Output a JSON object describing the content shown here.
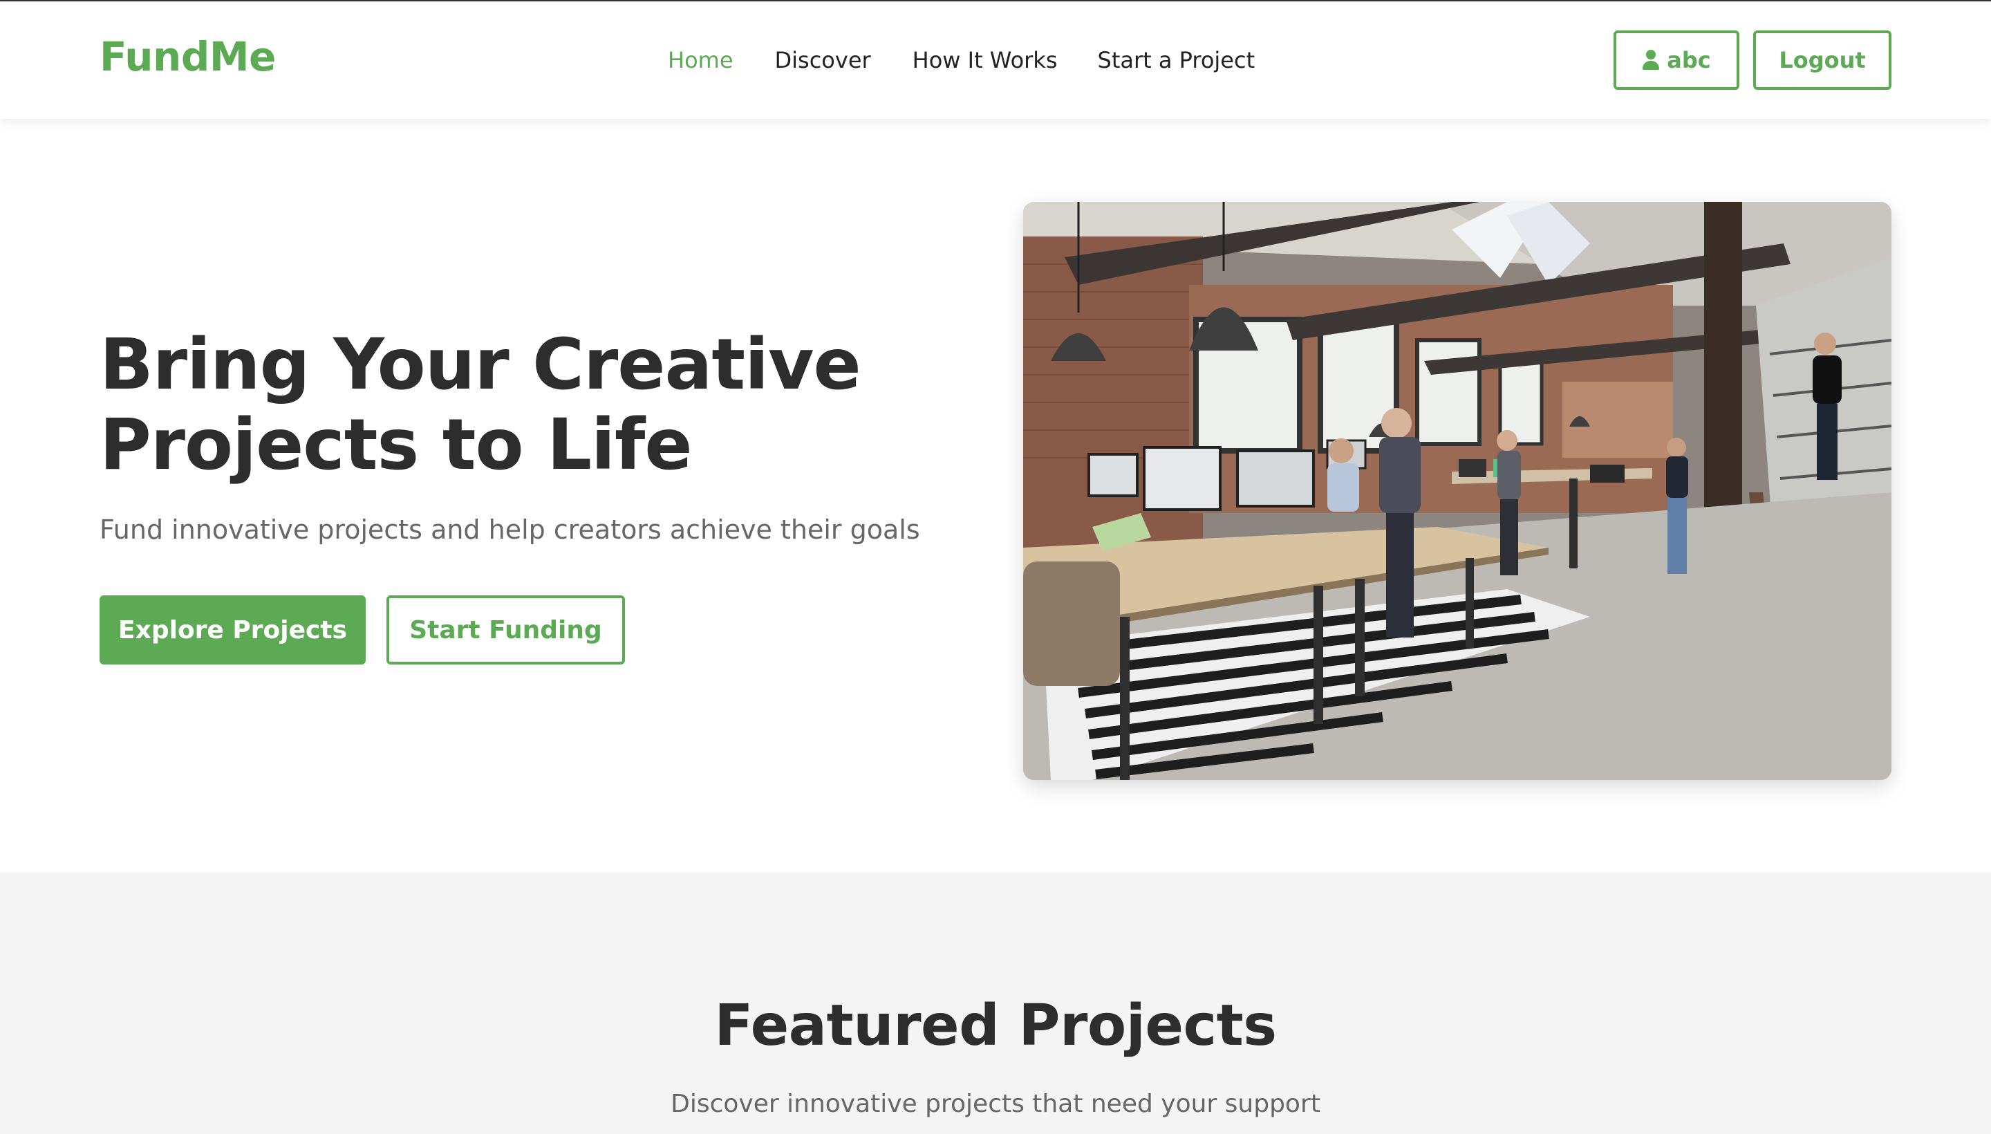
{
  "header": {
    "logo": "FundMe",
    "nav": [
      {
        "label": "Home",
        "active": true
      },
      {
        "label": "Discover"
      },
      {
        "label": "How It Works"
      },
      {
        "label": "Start a Project"
      }
    ],
    "user_label": "abc",
    "logout_label": "Logout"
  },
  "hero": {
    "title_line1": "Bring Your Creative",
    "title_line2": "Projects to Life",
    "subtitle": "Fund innovative projects and help creators achieve their goals",
    "primary_button": "Explore Projects",
    "secondary_button": "Start Funding"
  },
  "featured": {
    "title": "Featured Projects",
    "subtitle": "Discover innovative projects that need your support"
  },
  "colors": {
    "accent": "#5daa55",
    "text_dark": "#2d2d2d",
    "text_muted": "#666666",
    "section_bg": "#f4f4f4"
  }
}
